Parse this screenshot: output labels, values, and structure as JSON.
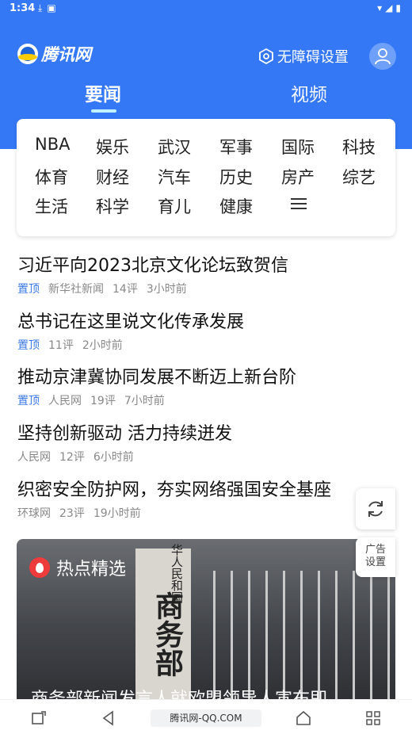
{
  "status_bar": {
    "time": "1:34",
    "left_icons": [
      "download-icon",
      "a-icon"
    ],
    "right_icons": [
      "wifi-icon",
      "signal-icon",
      "battery-icon"
    ]
  },
  "header": {
    "logo_text": "腾讯网",
    "accessibility_label": "无障碍设置",
    "tabs": [
      {
        "label": "要闻",
        "active": true
      },
      {
        "label": "视频",
        "active": false
      }
    ],
    "accent_color": "#3478f6"
  },
  "channels": [
    "NBA",
    "娱乐",
    "武汉",
    "军事",
    "国际",
    "科技",
    "体育",
    "财经",
    "汽车",
    "历史",
    "房产",
    "综艺",
    "生活",
    "科学",
    "育儿",
    "健康"
  ],
  "articles": [
    {
      "title": "习近平向2023北京文化论坛致贺信",
      "pin": "置顶",
      "source": "新华社新闻",
      "comments": "14评",
      "time": "3小时前"
    },
    {
      "title": "总书记在这里说文化传承发展",
      "pin": "置顶",
      "source": "",
      "comments": "11评",
      "time": "2小时前"
    },
    {
      "title": "推动京津冀协同发展不断迈上新台阶",
      "pin": "置顶",
      "source": "人民网",
      "comments": "19评",
      "time": "7小时前"
    },
    {
      "title": "坚持创新驱动 活力持续迸发",
      "pin": "",
      "source": "人民网",
      "comments": "12评",
      "time": "6小时前"
    },
    {
      "title": "织密安全防护网，夯实网络强国安全基座",
      "pin": "",
      "source": "环球网",
      "comments": "23评",
      "time": "19小时前"
    }
  ],
  "floating": {
    "ad_settings_line1": "广告",
    "ad_settings_line2": "设置"
  },
  "hot_picks": {
    "label": "热点精选",
    "sign_text": "商务部",
    "sign_small": "华人民和国",
    "caption": "商务部新闻发言人就欧盟领导人宣布即"
  },
  "bottom_nav": {
    "url": "腾讯网-QQ.COM"
  }
}
